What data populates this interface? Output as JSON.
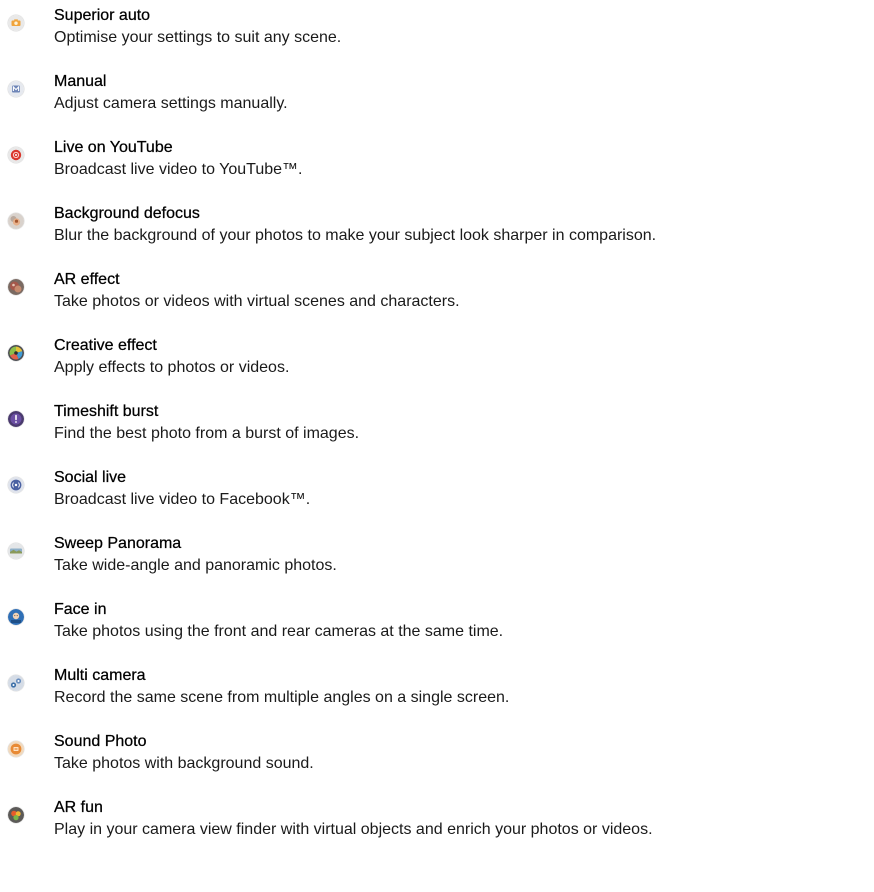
{
  "modes": [
    {
      "icon": "superior-auto-icon",
      "title": "Superior auto",
      "description": "Optimise your settings to suit any scene."
    },
    {
      "icon": "manual-icon",
      "title": "Manual",
      "description": "Adjust camera settings manually."
    },
    {
      "icon": "youtube-live-icon",
      "title": "Live on YouTube",
      "description": "Broadcast live video to YouTube™."
    },
    {
      "icon": "background-defocus-icon",
      "title": "Background defocus",
      "description": "Blur the background of your photos to make your subject look sharper in comparison."
    },
    {
      "icon": "ar-effect-icon",
      "title": "AR effect",
      "description": "Take photos or videos with virtual scenes and characters."
    },
    {
      "icon": "creative-effect-icon",
      "title": "Creative effect",
      "description": "Apply effects to photos or videos."
    },
    {
      "icon": "timeshift-burst-icon",
      "title": "Timeshift burst",
      "description": "Find the best photo from a burst of images."
    },
    {
      "icon": "social-live-icon",
      "title": "Social live",
      "description": "Broadcast live video to Facebook™."
    },
    {
      "icon": "sweep-panorama-icon",
      "title": "Sweep Panorama",
      "description": "Take wide-angle and panoramic photos."
    },
    {
      "icon": "face-in-icon",
      "title": "Face in",
      "description": "Take photos using the front and rear cameras at the same time."
    },
    {
      "icon": "multi-camera-icon",
      "title": "Multi camera",
      "description": "Record the same scene from multiple angles on a single screen."
    },
    {
      "icon": "sound-photo-icon",
      "title": "Sound Photo",
      "description": "Take photos with background sound."
    },
    {
      "icon": "ar-fun-icon",
      "title": "AR fun",
      "description": "Play in your camera view finder with virtual objects and enrich your photos or videos."
    }
  ]
}
